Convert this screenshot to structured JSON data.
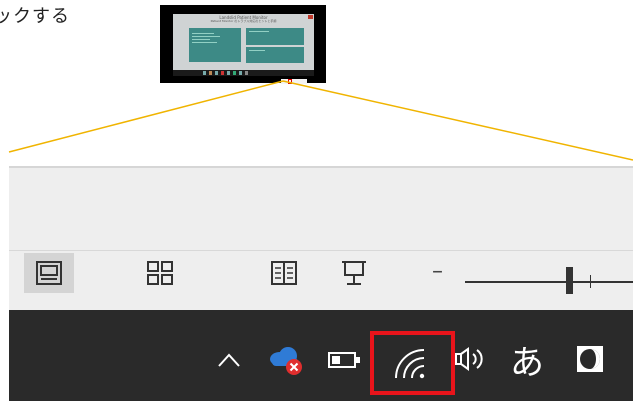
{
  "caption": "ックする",
  "thumbnail": {
    "title": "Landslid Patient Monitor",
    "subtitle": "Patient Monitor のトラブル対応のヒントと手順"
  },
  "ribbon": {
    "view_buttons": [
      "normal-view",
      "slide-sorter",
      "reading-view",
      "slide-show"
    ],
    "zoom_minus": "–",
    "zoom_level": 0.6
  },
  "taskbar": {
    "ime_label": "あ",
    "highlighted": "wifi"
  },
  "colors": {
    "highlight": "#e8141b",
    "zoom_line": "#f0b400",
    "taskbar": "#2a2a2a",
    "ribbon": "#eeeeee",
    "thumb_panel": "#3d8a86"
  }
}
